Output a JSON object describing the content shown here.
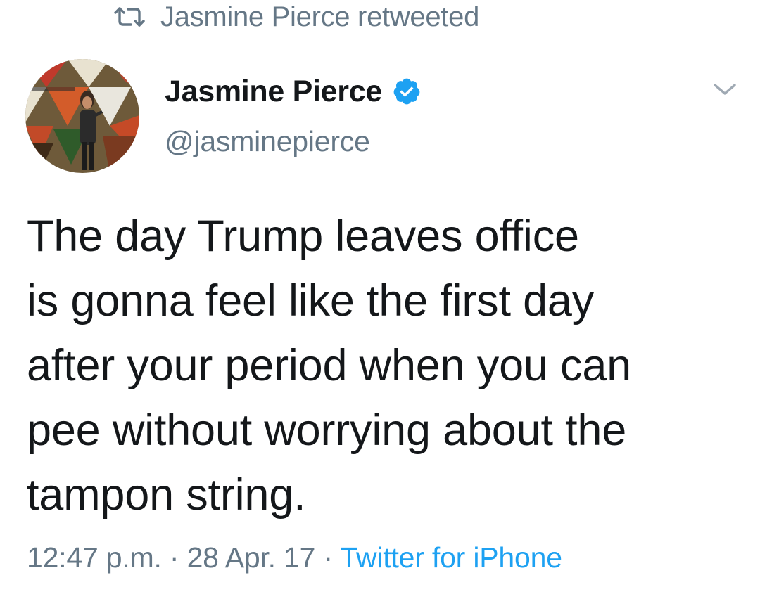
{
  "retweet": {
    "icon": "retweet-icon",
    "text": "Jasmine Pierce retweeted"
  },
  "author": {
    "display_name": "Jasmine Pierce",
    "handle": "@jasminepierce",
    "verified_icon": "verified-badge-icon",
    "avatar_icon": "avatar"
  },
  "menu": {
    "icon": "chevron-down-icon"
  },
  "tweet": {
    "lines": [
      "The day Trump leaves office",
      "is gonna feel like the first day",
      "after your period when you can",
      "pee without worrying about the",
      "tampon string."
    ]
  },
  "meta": {
    "time": "12:47 p.m.",
    "sep1": " · ",
    "date": "28 Apr. 17",
    "sep2": " · ",
    "source": "Twitter for iPhone"
  },
  "colors": {
    "text_primary": "#14171a",
    "text_secondary": "#657786",
    "link": "#1da1f2",
    "verified": "#1da1f2"
  }
}
